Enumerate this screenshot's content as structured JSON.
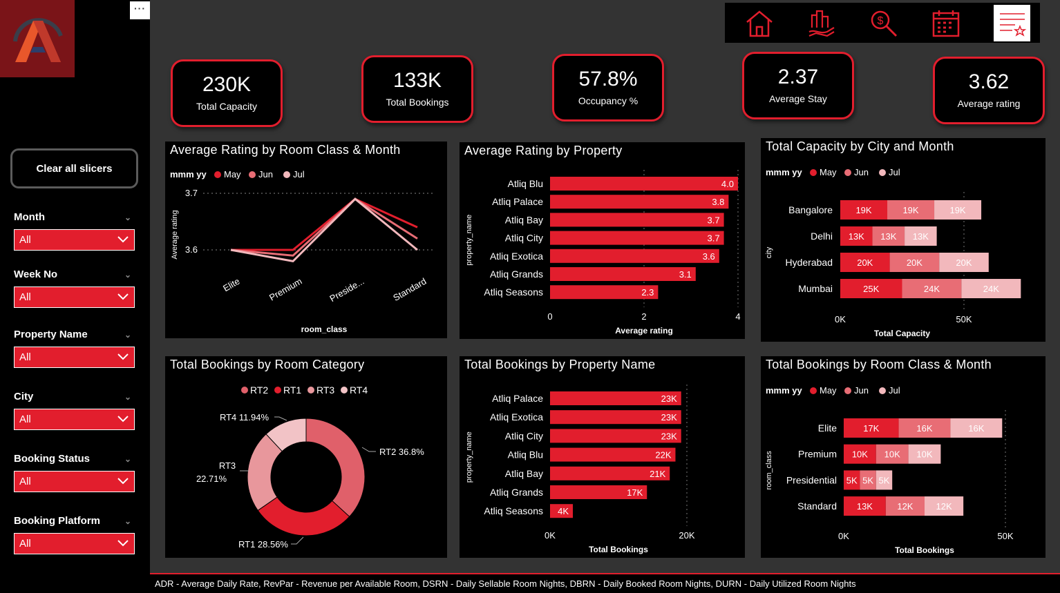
{
  "sidebar": {
    "more_label": "···",
    "clear_label": "Clear all slicers",
    "slicers": [
      {
        "title": "Month",
        "value": "All"
      },
      {
        "title": "Week No",
        "value": "All"
      },
      {
        "title": "Property Name",
        "value": "All"
      },
      {
        "title": "City",
        "value": "All"
      },
      {
        "title": "Booking Status",
        "value": "All"
      },
      {
        "title": "Booking Platform",
        "value": "All"
      }
    ]
  },
  "nav": {
    "icons": [
      "home-icon",
      "city-hand-icon",
      "dollar-search-icon",
      "calendar-icon",
      "list-star-icon"
    ],
    "active": "list-star-icon"
  },
  "kpis": [
    {
      "value": "230K",
      "label": "Total Capacity"
    },
    {
      "value": "133K",
      "label": "Total Bookings"
    },
    {
      "value": "57.8%",
      "label": "Occupancy %"
    },
    {
      "value": "2.37",
      "label": "Average Stay"
    },
    {
      "value": "3.62",
      "label": "Average rating"
    }
  ],
  "colors": {
    "accent": "#e21e2d",
    "may": "#e21e2d",
    "jun": "#e86d75",
    "jul": "#f2b8bc",
    "rt2": "#e0606a",
    "rt1": "#e21e2d",
    "rt3": "#e8979c",
    "rt4": "#f2c3c6"
  },
  "legend_months": {
    "title": "mmm yy",
    "items": [
      "May",
      "Jun",
      "Jul"
    ]
  },
  "charts": {
    "rating_room_class": {
      "title": "Average Rating by Room Class & Month",
      "xlabel": "room_class",
      "ylabel": "Average rating"
    },
    "rating_property": {
      "title": "Average Rating by Property",
      "xlabel": "Average rating",
      "ylabel": "property_name"
    },
    "capacity_city": {
      "title": "Total Capacity by City and Month",
      "xlabel": "Total Capacity",
      "ylabel": "city"
    },
    "bookings_category": {
      "title": "Total Bookings by Room Category"
    },
    "bookings_property": {
      "title": "Total Bookings by Property Name",
      "xlabel": "Total Bookings",
      "ylabel": "property_name"
    },
    "bookings_room_class": {
      "title": "Total Bookings by Room Class & Month",
      "xlabel": "Total Bookings",
      "ylabel": "room_class"
    }
  },
  "chart_data": [
    {
      "id": "rating_room_class",
      "type": "line",
      "title": "Average Rating by Room Class & Month",
      "xlabel": "room_class",
      "ylabel": "Average rating",
      "categories": [
        "Elite",
        "Premium",
        "Preside...",
        "Standard"
      ],
      "series": [
        {
          "name": "May",
          "values": [
            3.6,
            3.6,
            3.69,
            3.64
          ]
        },
        {
          "name": "Jun",
          "values": [
            3.6,
            3.59,
            3.69,
            3.62
          ]
        },
        {
          "name": "Jul",
          "values": [
            3.6,
            3.58,
            3.69,
            3.6
          ]
        }
      ],
      "yticks": [
        "3.6",
        "3.7"
      ],
      "ylim": [
        3.6,
        3.7
      ],
      "legend": "top-left"
    },
    {
      "id": "rating_property",
      "type": "bar",
      "orientation": "horizontal",
      "title": "Average Rating by Property",
      "xlabel": "Average rating",
      "ylabel": "property_name",
      "categories": [
        "Atliq Blu",
        "Atliq Palace",
        "Atliq Bay",
        "Atliq City",
        "Atliq Exotica",
        "Atliq Grands",
        "Atliq Seasons"
      ],
      "values": [
        4.0,
        3.8,
        3.7,
        3.7,
        3.6,
        3.1,
        2.3
      ],
      "labels": [
        "4.0",
        "3.8",
        "3.7",
        "3.7",
        "3.6",
        "3.1",
        "2.3"
      ],
      "xticks": [
        "0",
        "2",
        "4"
      ],
      "xlim": [
        0,
        4
      ]
    },
    {
      "id": "capacity_city",
      "type": "bar",
      "orientation": "horizontal",
      "stacked": true,
      "title": "Total Capacity by City and Month",
      "xlabel": "Total Capacity",
      "ylabel": "city",
      "categories": [
        "Bangalore",
        "Delhi",
        "Hyderabad",
        "Mumbai"
      ],
      "series": [
        {
          "name": "May",
          "values": [
            19,
            13,
            20,
            25
          ],
          "labels": [
            "19K",
            "13K",
            "20K",
            "25K"
          ]
        },
        {
          "name": "Jun",
          "values": [
            19,
            13,
            20,
            24
          ],
          "labels": [
            "19K",
            "13K",
            "20K",
            "24K"
          ]
        },
        {
          "name": "Jul",
          "values": [
            19,
            13,
            20,
            24
          ],
          "labels": [
            "19K",
            "13K",
            "20K",
            "24K"
          ]
        }
      ],
      "xticks": [
        "0K",
        "50K"
      ],
      "xlim": [
        0,
        50
      ]
    },
    {
      "id": "bookings_category",
      "type": "pie",
      "donut": true,
      "title": "Total Bookings by Room Category",
      "legend": [
        "RT2",
        "RT1",
        "RT3",
        "RT4"
      ],
      "slices": [
        {
          "name": "RT2",
          "value": 36.8,
          "label": "RT2 36.8%"
        },
        {
          "name": "RT1",
          "value": 28.56,
          "label": "RT1 28.56%"
        },
        {
          "name": "RT3",
          "value": 22.71,
          "label_top": "RT3",
          "label_bottom": "22.71%"
        },
        {
          "name": "RT4",
          "value": 11.94,
          "label": "RT4 11.94%"
        }
      ]
    },
    {
      "id": "bookings_property",
      "type": "bar",
      "orientation": "horizontal",
      "title": "Total Bookings by Property Name",
      "xlabel": "Total Bookings",
      "ylabel": "property_name",
      "categories": [
        "Atliq Palace",
        "Atliq Exotica",
        "Atliq City",
        "Atliq Blu",
        "Atliq Bay",
        "Atliq Grands",
        "Atliq Seasons"
      ],
      "values": [
        23,
        23,
        23,
        22,
        21,
        17,
        4
      ],
      "labels": [
        "23K",
        "23K",
        "23K",
        "22K",
        "21K",
        "17K",
        "4K"
      ],
      "xticks": [
        "0K",
        "20K"
      ],
      "xlim": [
        0,
        24
      ]
    },
    {
      "id": "bookings_room_class",
      "type": "bar",
      "orientation": "horizontal",
      "stacked": true,
      "title": "Total Bookings by Room Class & Month",
      "xlabel": "Total Bookings",
      "ylabel": "room_class",
      "categories": [
        "Elite",
        "Premium",
        "Presidential",
        "Standard"
      ],
      "series": [
        {
          "name": "May",
          "values": [
            17,
            10,
            5,
            13
          ],
          "labels": [
            "17K",
            "10K",
            "5K",
            "13K"
          ]
        },
        {
          "name": "Jun",
          "values": [
            16,
            10,
            5,
            12
          ],
          "labels": [
            "16K",
            "10K",
            "5K",
            "12K"
          ]
        },
        {
          "name": "Jul",
          "values": [
            16,
            10,
            5,
            12
          ],
          "labels": [
            "16K",
            "10K",
            "5K",
            "12K"
          ]
        }
      ],
      "xticks": [
        "0K",
        "50K"
      ],
      "xlim": [
        0,
        50
      ]
    }
  ],
  "footer": {
    "text": "ADR - Average Daily Rate, RevPar - Revenue per Available Room, DSRN - Daily Sellable Room Nights, DBRN - Daily Booked Room Nights, DURN - Daily Utilized Room Nights"
  }
}
